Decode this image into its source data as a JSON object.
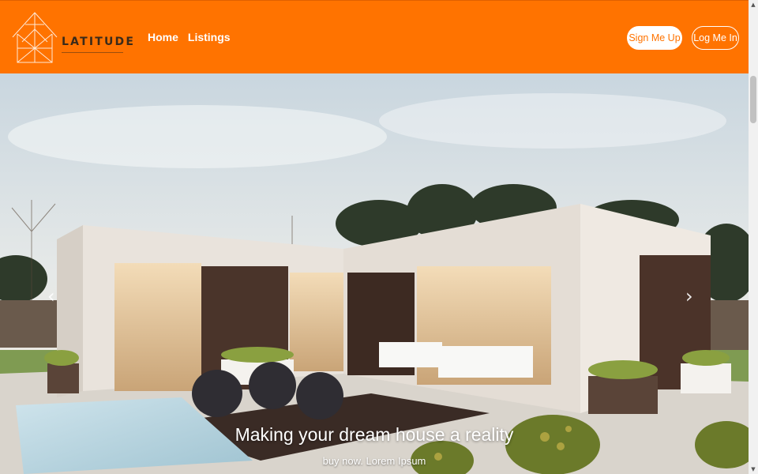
{
  "brand": {
    "name": "LATITUDE",
    "logo_icon": "house-outline-icon"
  },
  "nav": {
    "links": [
      {
        "label": "Home"
      },
      {
        "label": "Listings"
      }
    ]
  },
  "auth": {
    "signup_label": "Sign Me Up",
    "login_label": "Log Me In"
  },
  "hero": {
    "title": "Making your dream house a reality",
    "subtitle": "buy now. Lorem Ipsum",
    "prev_icon": "chevron-left-icon",
    "next_icon": "chevron-right-icon",
    "prev_glyph": "‹",
    "next_glyph": "›"
  },
  "colors": {
    "accent": "#ff7300",
    "white": "#ffffff"
  }
}
